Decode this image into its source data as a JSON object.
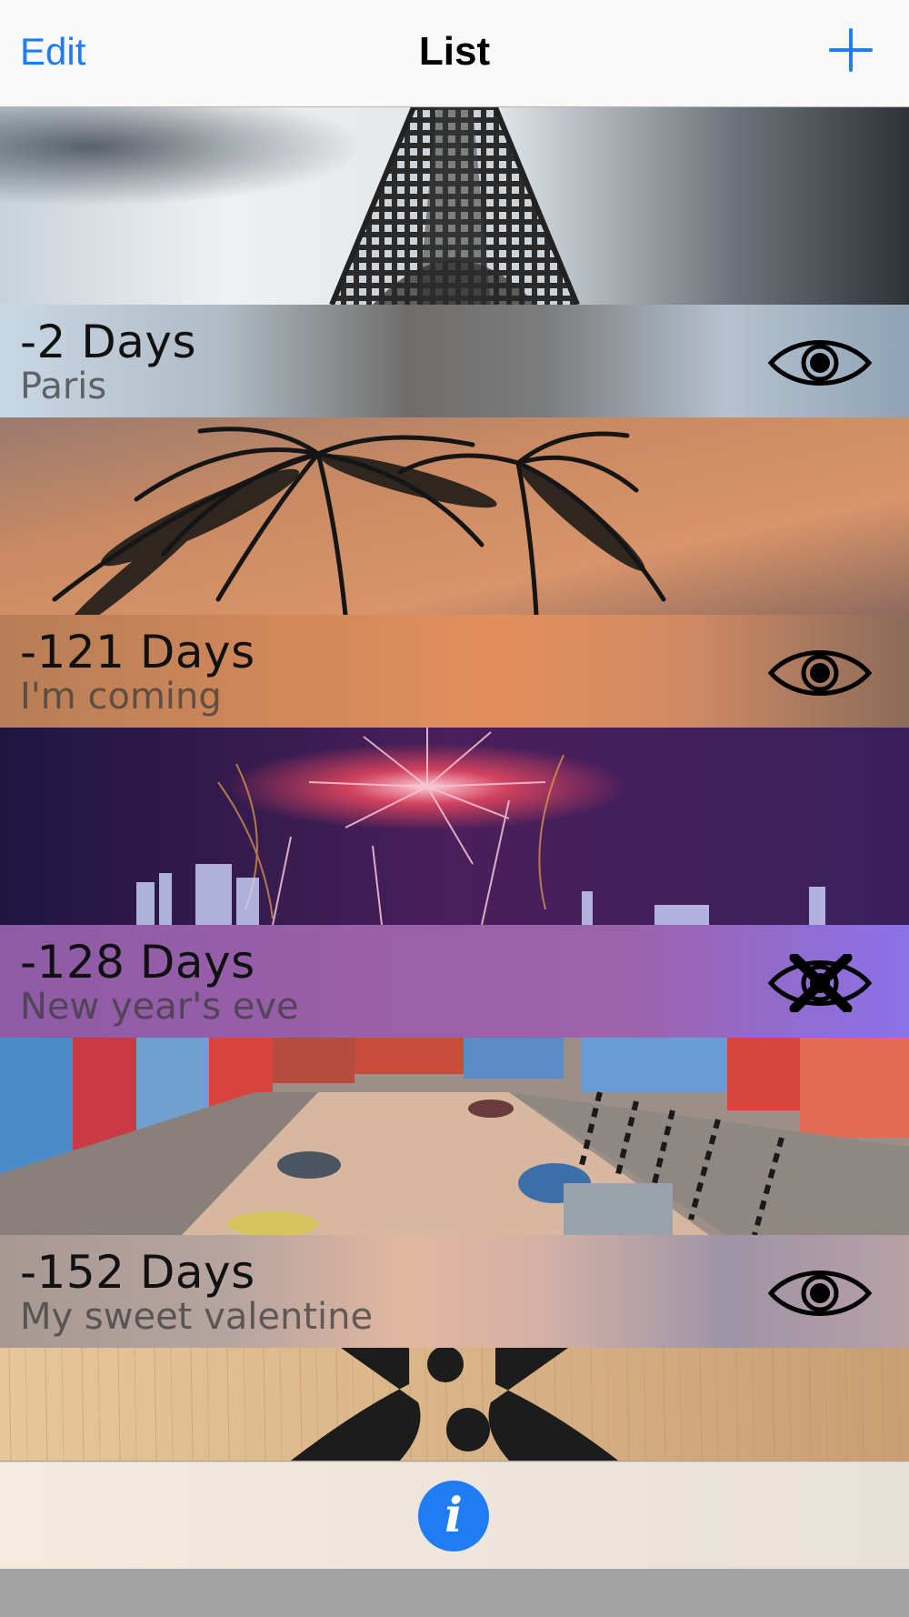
{
  "navbar": {
    "edit_label": "Edit",
    "title": "List",
    "add_icon": "plus-icon"
  },
  "colors": {
    "tint": "#1f7cf3",
    "navbar_bg": "#f8f8f9"
  },
  "events": [
    {
      "days": "-2 Days",
      "name": "Paris",
      "photo": "eiffel-tower",
      "visibility_icon": "eye-icon",
      "visible": true
    },
    {
      "days": "-121 Days",
      "name": "I'm coming",
      "photo": "palm-trees-sunset",
      "visibility_icon": "eye-icon",
      "visible": true
    },
    {
      "days": "-128 Days",
      "name": "New year's eve",
      "photo": "fireworks-city",
      "visibility_icon": "eye-crossed-icon",
      "visible": false
    },
    {
      "days": "-152 Days",
      "name": "My sweet valentine",
      "photo": "venice-canal",
      "visibility_icon": "eye-icon",
      "visible": true
    }
  ],
  "partial_event": {
    "photo": "wooden-pattern"
  },
  "toolbar": {
    "info_icon": "info-icon",
    "info_glyph": "i"
  }
}
